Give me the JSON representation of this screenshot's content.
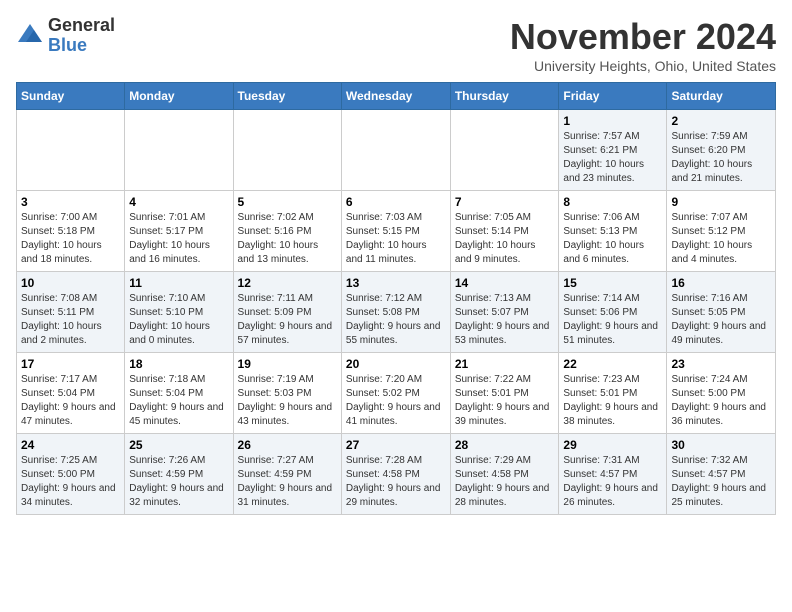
{
  "logo": {
    "general": "General",
    "blue": "Blue"
  },
  "header": {
    "month": "November 2024",
    "location": "University Heights, Ohio, United States"
  },
  "days_of_week": [
    "Sunday",
    "Monday",
    "Tuesday",
    "Wednesday",
    "Thursday",
    "Friday",
    "Saturday"
  ],
  "weeks": [
    [
      {
        "day": "",
        "sunrise": "",
        "sunset": "",
        "daylight": ""
      },
      {
        "day": "",
        "sunrise": "",
        "sunset": "",
        "daylight": ""
      },
      {
        "day": "",
        "sunrise": "",
        "sunset": "",
        "daylight": ""
      },
      {
        "day": "",
        "sunrise": "",
        "sunset": "",
        "daylight": ""
      },
      {
        "day": "",
        "sunrise": "",
        "sunset": "",
        "daylight": ""
      },
      {
        "day": "1",
        "sunrise": "Sunrise: 7:57 AM",
        "sunset": "Sunset: 6:21 PM",
        "daylight": "Daylight: 10 hours and 23 minutes."
      },
      {
        "day": "2",
        "sunrise": "Sunrise: 7:59 AM",
        "sunset": "Sunset: 6:20 PM",
        "daylight": "Daylight: 10 hours and 21 minutes."
      }
    ],
    [
      {
        "day": "3",
        "sunrise": "Sunrise: 7:00 AM",
        "sunset": "Sunset: 5:18 PM",
        "daylight": "Daylight: 10 hours and 18 minutes."
      },
      {
        "day": "4",
        "sunrise": "Sunrise: 7:01 AM",
        "sunset": "Sunset: 5:17 PM",
        "daylight": "Daylight: 10 hours and 16 minutes."
      },
      {
        "day": "5",
        "sunrise": "Sunrise: 7:02 AM",
        "sunset": "Sunset: 5:16 PM",
        "daylight": "Daylight: 10 hours and 13 minutes."
      },
      {
        "day": "6",
        "sunrise": "Sunrise: 7:03 AM",
        "sunset": "Sunset: 5:15 PM",
        "daylight": "Daylight: 10 hours and 11 minutes."
      },
      {
        "day": "7",
        "sunrise": "Sunrise: 7:05 AM",
        "sunset": "Sunset: 5:14 PM",
        "daylight": "Daylight: 10 hours and 9 minutes."
      },
      {
        "day": "8",
        "sunrise": "Sunrise: 7:06 AM",
        "sunset": "Sunset: 5:13 PM",
        "daylight": "Daylight: 10 hours and 6 minutes."
      },
      {
        "day": "9",
        "sunrise": "Sunrise: 7:07 AM",
        "sunset": "Sunset: 5:12 PM",
        "daylight": "Daylight: 10 hours and 4 minutes."
      }
    ],
    [
      {
        "day": "10",
        "sunrise": "Sunrise: 7:08 AM",
        "sunset": "Sunset: 5:11 PM",
        "daylight": "Daylight: 10 hours and 2 minutes."
      },
      {
        "day": "11",
        "sunrise": "Sunrise: 7:10 AM",
        "sunset": "Sunset: 5:10 PM",
        "daylight": "Daylight: 10 hours and 0 minutes."
      },
      {
        "day": "12",
        "sunrise": "Sunrise: 7:11 AM",
        "sunset": "Sunset: 5:09 PM",
        "daylight": "Daylight: 9 hours and 57 minutes."
      },
      {
        "day": "13",
        "sunrise": "Sunrise: 7:12 AM",
        "sunset": "Sunset: 5:08 PM",
        "daylight": "Daylight: 9 hours and 55 minutes."
      },
      {
        "day": "14",
        "sunrise": "Sunrise: 7:13 AM",
        "sunset": "Sunset: 5:07 PM",
        "daylight": "Daylight: 9 hours and 53 minutes."
      },
      {
        "day": "15",
        "sunrise": "Sunrise: 7:14 AM",
        "sunset": "Sunset: 5:06 PM",
        "daylight": "Daylight: 9 hours and 51 minutes."
      },
      {
        "day": "16",
        "sunrise": "Sunrise: 7:16 AM",
        "sunset": "Sunset: 5:05 PM",
        "daylight": "Daylight: 9 hours and 49 minutes."
      }
    ],
    [
      {
        "day": "17",
        "sunrise": "Sunrise: 7:17 AM",
        "sunset": "Sunset: 5:04 PM",
        "daylight": "Daylight: 9 hours and 47 minutes."
      },
      {
        "day": "18",
        "sunrise": "Sunrise: 7:18 AM",
        "sunset": "Sunset: 5:04 PM",
        "daylight": "Daylight: 9 hours and 45 minutes."
      },
      {
        "day": "19",
        "sunrise": "Sunrise: 7:19 AM",
        "sunset": "Sunset: 5:03 PM",
        "daylight": "Daylight: 9 hours and 43 minutes."
      },
      {
        "day": "20",
        "sunrise": "Sunrise: 7:20 AM",
        "sunset": "Sunset: 5:02 PM",
        "daylight": "Daylight: 9 hours and 41 minutes."
      },
      {
        "day": "21",
        "sunrise": "Sunrise: 7:22 AM",
        "sunset": "Sunset: 5:01 PM",
        "daylight": "Daylight: 9 hours and 39 minutes."
      },
      {
        "day": "22",
        "sunrise": "Sunrise: 7:23 AM",
        "sunset": "Sunset: 5:01 PM",
        "daylight": "Daylight: 9 hours and 38 minutes."
      },
      {
        "day": "23",
        "sunrise": "Sunrise: 7:24 AM",
        "sunset": "Sunset: 5:00 PM",
        "daylight": "Daylight: 9 hours and 36 minutes."
      }
    ],
    [
      {
        "day": "24",
        "sunrise": "Sunrise: 7:25 AM",
        "sunset": "Sunset: 5:00 PM",
        "daylight": "Daylight: 9 hours and 34 minutes."
      },
      {
        "day": "25",
        "sunrise": "Sunrise: 7:26 AM",
        "sunset": "Sunset: 4:59 PM",
        "daylight": "Daylight: 9 hours and 32 minutes."
      },
      {
        "day": "26",
        "sunrise": "Sunrise: 7:27 AM",
        "sunset": "Sunset: 4:59 PM",
        "daylight": "Daylight: 9 hours and 31 minutes."
      },
      {
        "day": "27",
        "sunrise": "Sunrise: 7:28 AM",
        "sunset": "Sunset: 4:58 PM",
        "daylight": "Daylight: 9 hours and 29 minutes."
      },
      {
        "day": "28",
        "sunrise": "Sunrise: 7:29 AM",
        "sunset": "Sunset: 4:58 PM",
        "daylight": "Daylight: 9 hours and 28 minutes."
      },
      {
        "day": "29",
        "sunrise": "Sunrise: 7:31 AM",
        "sunset": "Sunset: 4:57 PM",
        "daylight": "Daylight: 9 hours and 26 minutes."
      },
      {
        "day": "30",
        "sunrise": "Sunrise: 7:32 AM",
        "sunset": "Sunset: 4:57 PM",
        "daylight": "Daylight: 9 hours and 25 minutes."
      }
    ]
  ]
}
